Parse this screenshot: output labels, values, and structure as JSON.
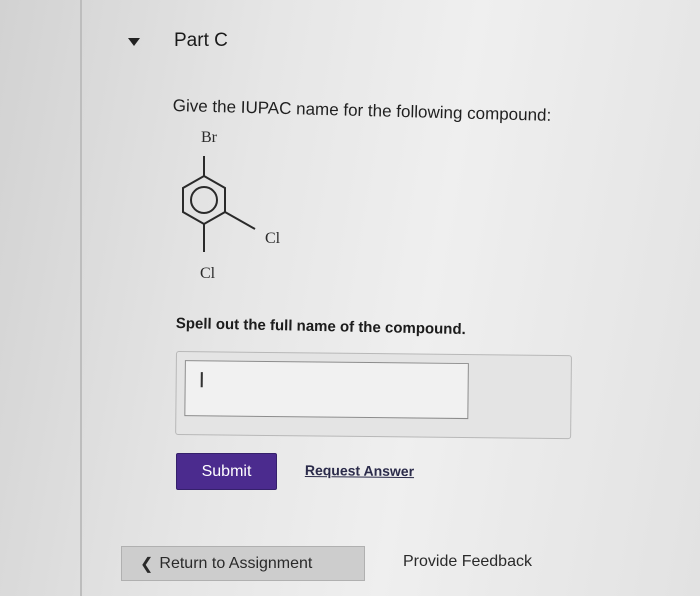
{
  "part": {
    "title": "Part C"
  },
  "question": {
    "prompt": "Give the IUPAC name for the following compound:",
    "atoms": {
      "top": "Br",
      "right": "Cl",
      "bottom": "Cl"
    },
    "instruction": "Spell out the full name of the compound."
  },
  "answer": {
    "value": "",
    "placeholder": ""
  },
  "actions": {
    "submit_label": "Submit",
    "request_answer_label": "Request Answer"
  },
  "footer": {
    "return_label": "Return to Assignment",
    "feedback_label": "Provide Feedback"
  },
  "colors": {
    "submit_bg": "#4b2b8e"
  }
}
